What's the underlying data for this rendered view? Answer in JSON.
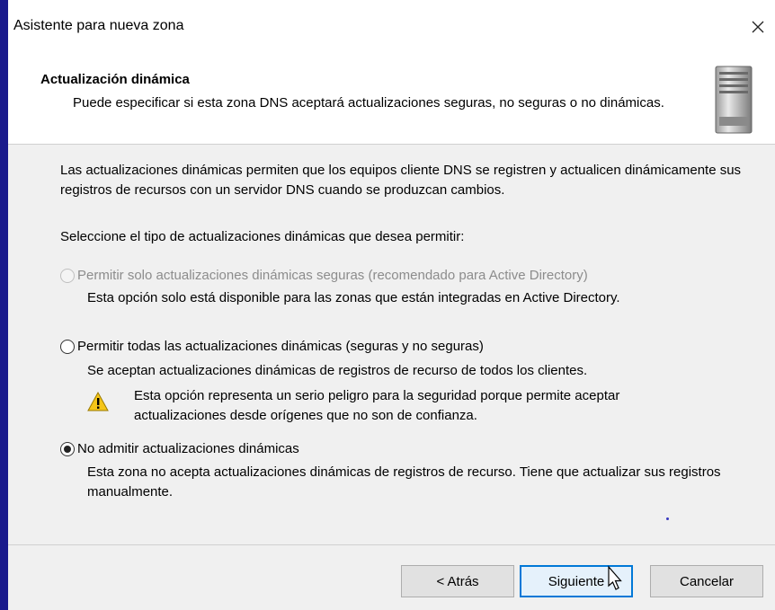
{
  "window": {
    "title": "Asistente para nueva zona",
    "close_symbol": "✕"
  },
  "header": {
    "title": "Actualización dinámica",
    "subtitle": "Puede especificar si esta zona DNS aceptará actualizaciones seguras, no seguras o no dinámicas.",
    "icon": "server-icon"
  },
  "content": {
    "intro": "Las actualizaciones dinámicas permiten que los equipos cliente DNS se registren y actualicen dinámicamente sus registros de recursos con un servidor DNS cuando se produzcan cambios.",
    "select_label": "Seleccione el tipo de actualizaciones dinámicas que desea permitir:",
    "options": [
      {
        "label": "Permitir solo actualizaciones dinámicas seguras (recomendado para Active Directory)",
        "description": "Esta opción solo está disponible para las zonas que están integradas en Active Directory.",
        "disabled": true,
        "checked": false
      },
      {
        "label": "Permitir todas las actualizaciones dinámicas (seguras y no seguras)",
        "description": "Se aceptan actualizaciones dinámicas de registros de recurso de todos los clientes.",
        "disabled": false,
        "checked": false
      },
      {
        "label": "No admitir actualizaciones dinámicas",
        "description": "Esta zona no acepta actualizaciones dinámicas de registros de recurso. Tiene que actualizar sus registros manualmente.",
        "disabled": false,
        "checked": true
      }
    ],
    "warning": {
      "icon": "warning-icon",
      "text": "Esta opción representa un serio peligro para la seguridad porque permite aceptar actualizaciones desde orígenes que no son de confianza."
    }
  },
  "footer": {
    "back_label": "< Atrás",
    "next_label": "Siguiente",
    "cancel_label": "Cancelar"
  },
  "colors": {
    "accent": "#0078d7",
    "outer_background": "#1a1a8c",
    "dialog_background": "#f0f0f0"
  }
}
